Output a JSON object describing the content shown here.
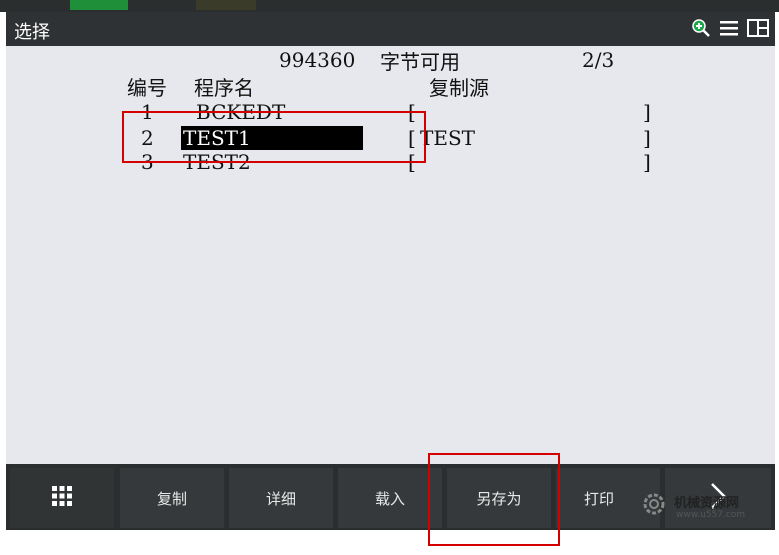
{
  "window": {
    "title": "选择"
  },
  "status": {
    "free_bytes": "994360",
    "free_label": "字节可用",
    "page": "2/3"
  },
  "table": {
    "headers": {
      "number": "编号",
      "name": "程序名",
      "source": "复制源"
    },
    "rows": [
      {
        "no": "1",
        "name": "BCKEDT",
        "source": ""
      },
      {
        "no": "2",
        "name": "TEST1",
        "source": "TEST"
      },
      {
        "no": "3",
        "name": "TEST2",
        "source": ""
      }
    ],
    "selected_row": 2
  },
  "softkeys": {
    "menu": "",
    "copy": "复制",
    "detail": "详细",
    "load": "载入",
    "save_as": "另存为",
    "print": "打印",
    "next": ">"
  },
  "icons": [
    "zoom-in-icon",
    "list-icon",
    "split-view-icon",
    "grid-menu-icon",
    "chevron-right-icon"
  ],
  "colors": {
    "highlight_bg": "#000000",
    "annotation": "#d40000",
    "titlebar": "#2f3234"
  },
  "watermark": {
    "text": "机械资源网",
    "url": "www.u557.com"
  }
}
